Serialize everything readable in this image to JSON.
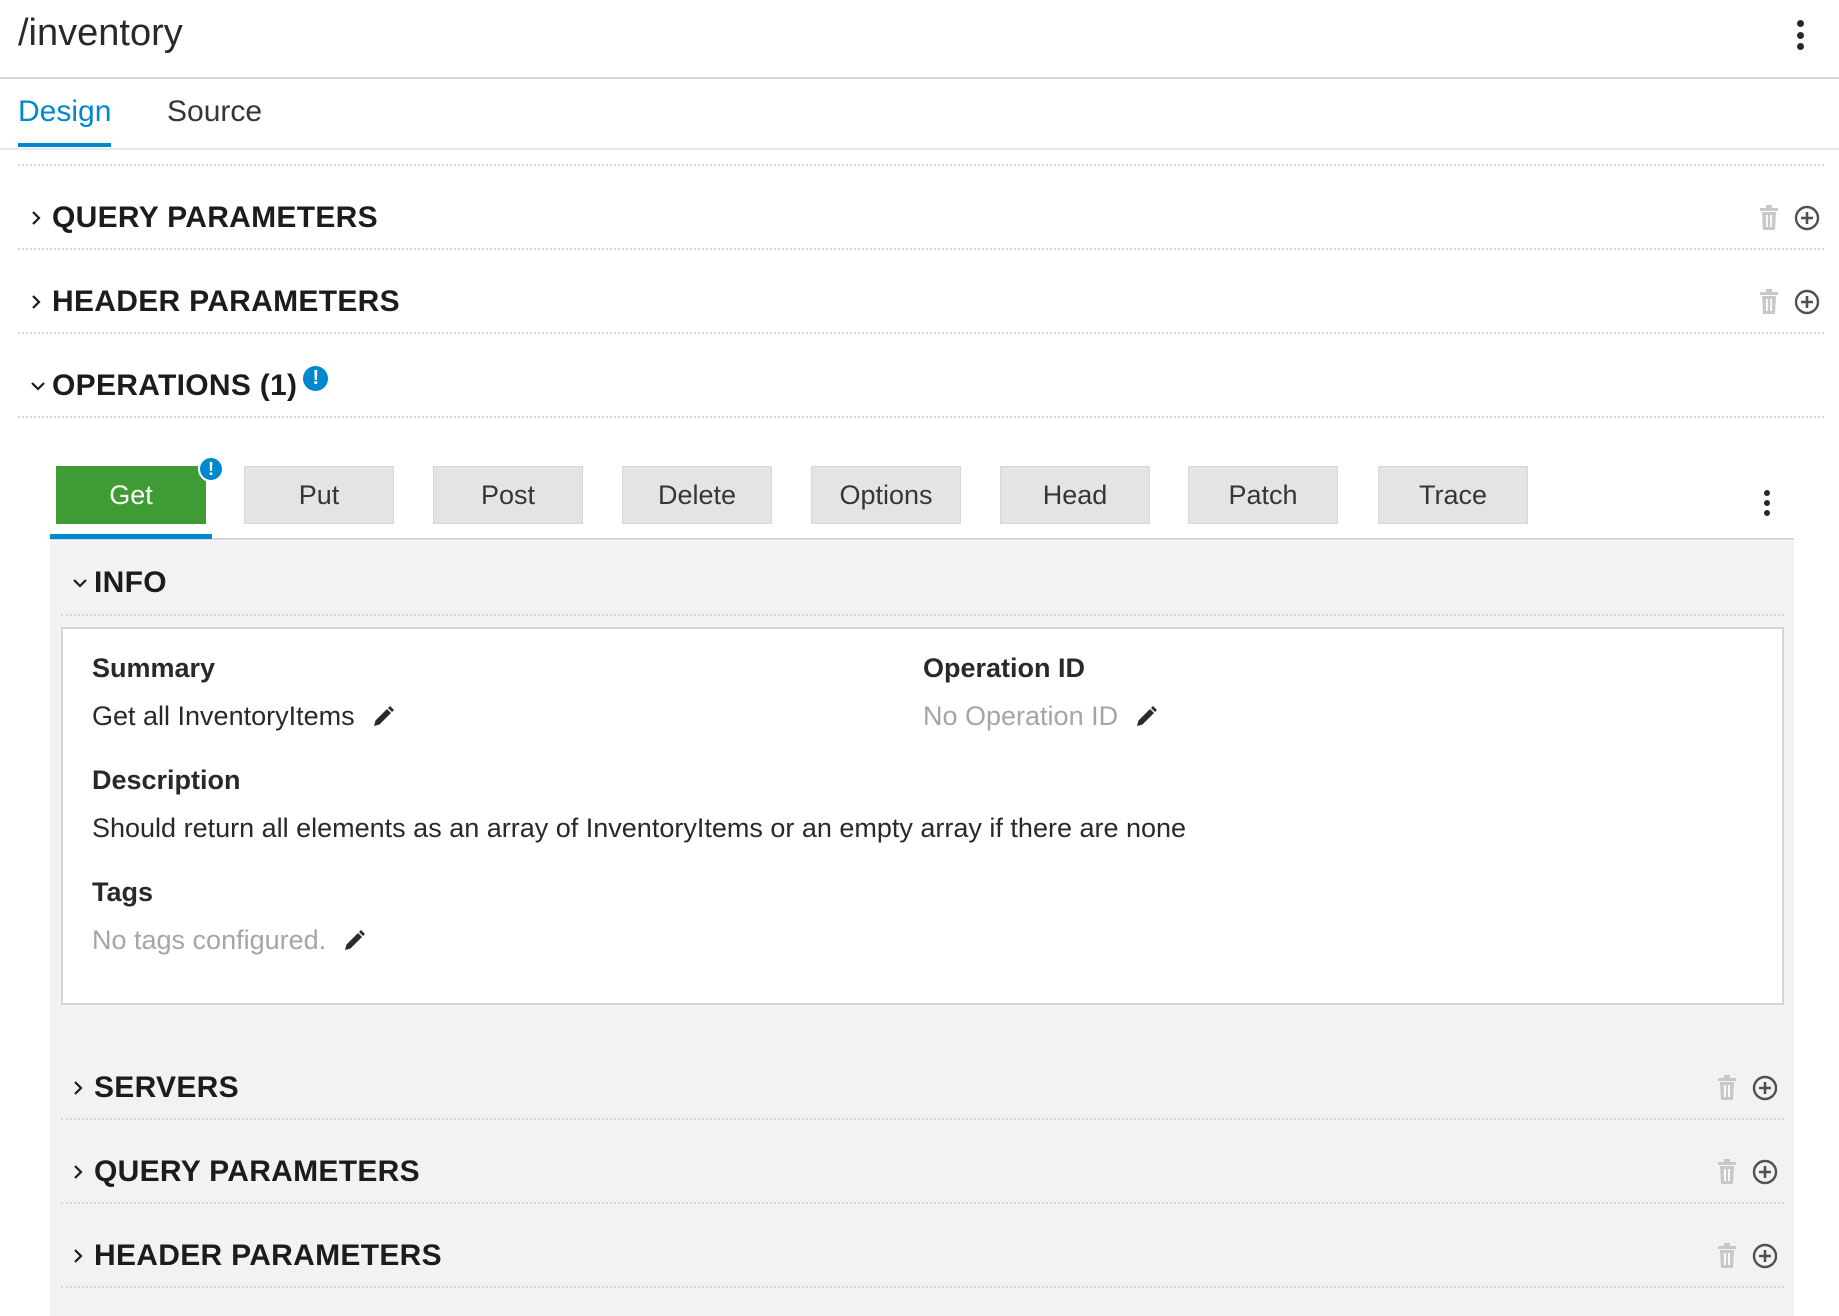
{
  "header": {
    "path": "/inventory"
  },
  "tabs": [
    {
      "label": "Design"
    },
    {
      "label": "Source"
    }
  ],
  "sections": {
    "query_parameters": "QUERY PARAMETERS",
    "header_parameters": "HEADER PARAMETERS",
    "operations": "OPERATIONS (1)"
  },
  "badge_glyph": "!",
  "methods": [
    {
      "label": "Get"
    },
    {
      "label": "Put"
    },
    {
      "label": "Post"
    },
    {
      "label": "Delete"
    },
    {
      "label": "Options"
    },
    {
      "label": "Head"
    },
    {
      "label": "Patch"
    },
    {
      "label": "Trace"
    }
  ],
  "operation": {
    "info_title": "INFO",
    "summary_label": "Summary",
    "summary_value": "Get all InventoryItems",
    "operation_id_label": "Operation ID",
    "operation_id_placeholder": "No Operation ID",
    "description_label": "Description",
    "description_value": "Should return all elements as an array of InventoryItems or an empty array if there are none",
    "tags_label": "Tags",
    "tags_placeholder": "No tags configured.",
    "servers": "SERVERS",
    "query_parameters": "QUERY PARAMETERS",
    "header_parameters": "HEADER PARAMETERS"
  },
  "colors": {
    "accent": "#0088ce",
    "active_method": "#3f9c35",
    "muted_text": "#a5a5a5"
  }
}
